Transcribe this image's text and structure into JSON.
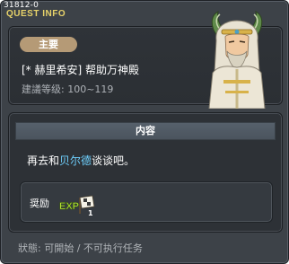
{
  "window": {
    "quest_id": "31812-0",
    "title": "QUEST INFO",
    "close_icon": "close-icon"
  },
  "summary": {
    "badge": "主要",
    "quest_name": "[* 赫里希安] 帮助万神殿",
    "level_range": "建議等级: 100~119"
  },
  "content": {
    "header": "内容",
    "text_before": "再去和",
    "npc_name": "贝尔德",
    "text_after": "谈谈吧。",
    "npc_name_color": "#6fd1ff"
  },
  "reward": {
    "label": "奨励",
    "icon": "exp-icon",
    "exp_text": "EXP",
    "count": "1"
  },
  "status": {
    "text": "狀態: 可開始 / 不可执行任务"
  },
  "colors": {
    "title": "#e8d36a",
    "badge": "#b59a76",
    "window_bg": "#3d4248"
  }
}
